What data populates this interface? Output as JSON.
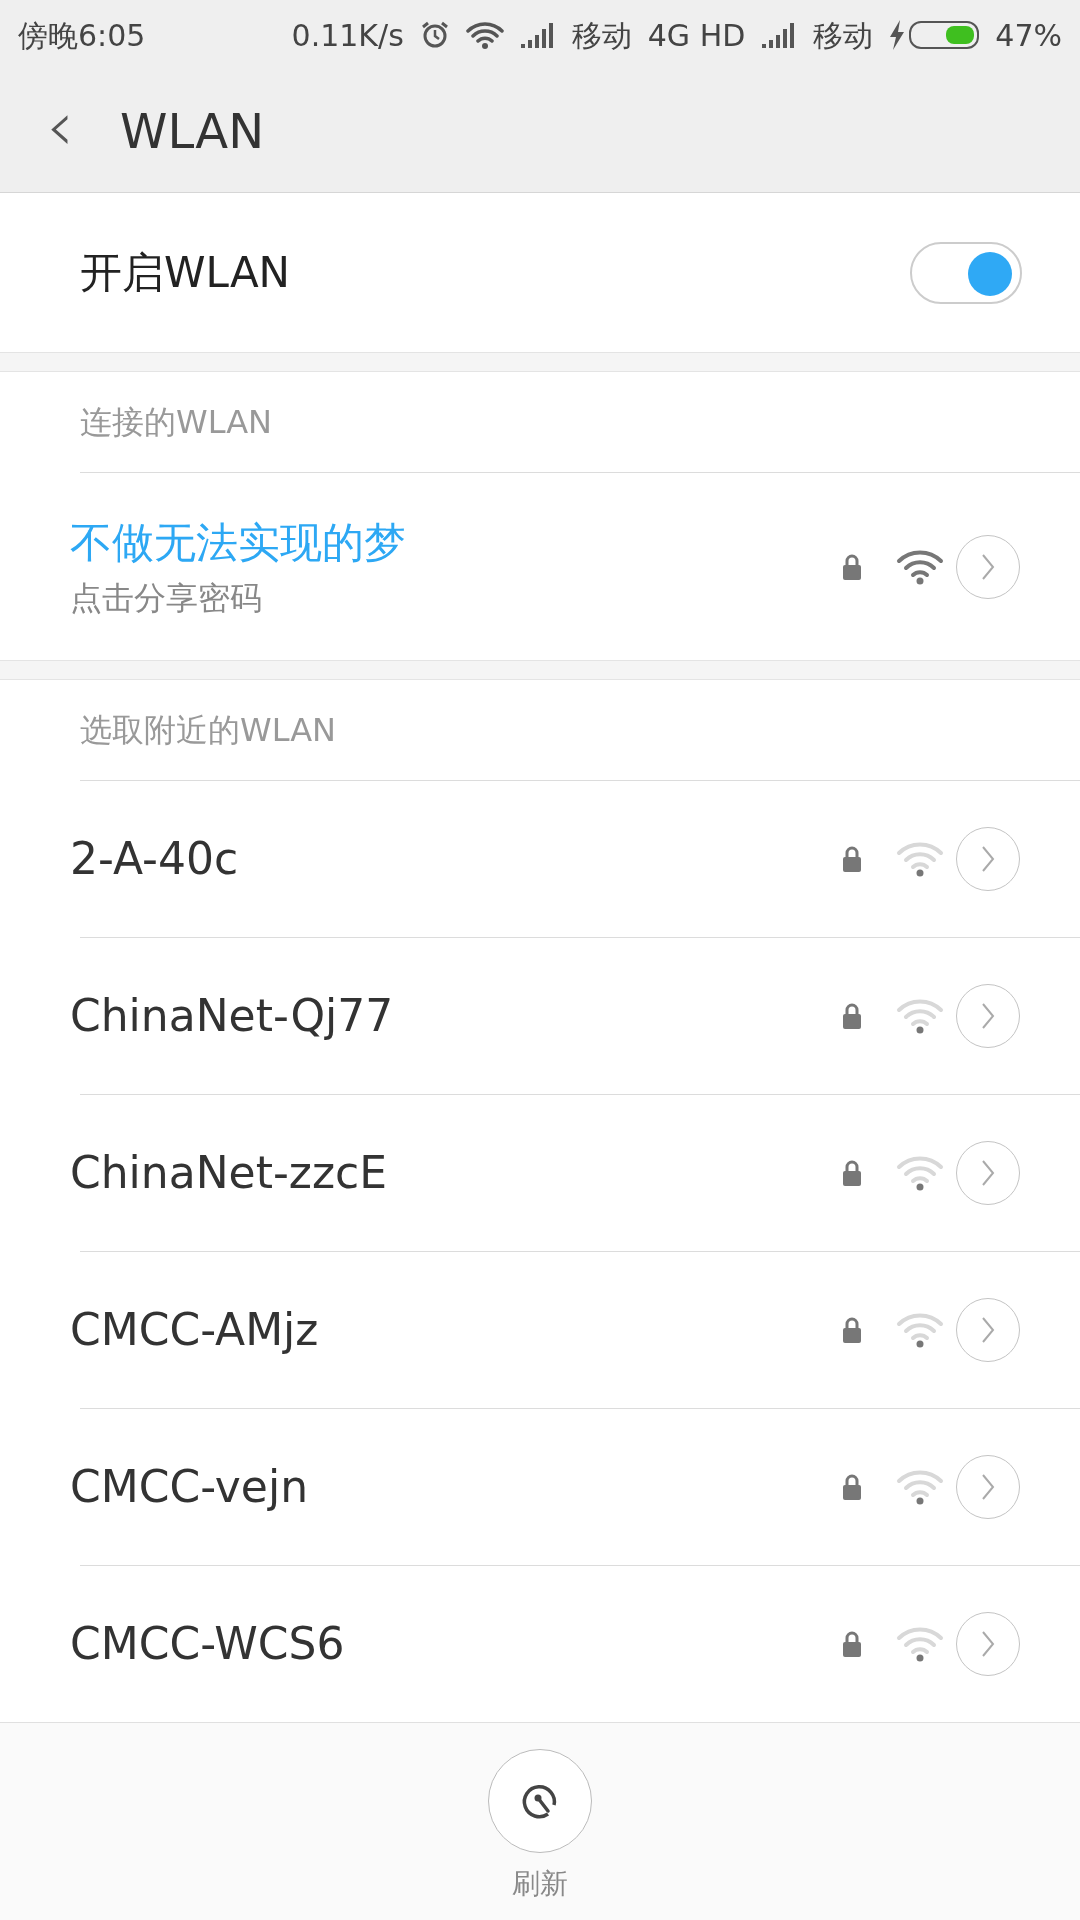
{
  "status_bar": {
    "time": "傍晚6:05",
    "speed": "0.11K/s",
    "carrier_1": "移动",
    "network_type": "4G HD",
    "carrier_2": "移动",
    "battery": {
      "level": 0.47,
      "charging": true
    },
    "battery_text": "47%"
  },
  "header": {
    "back": "‹",
    "title": "WLAN"
  },
  "toggle": {
    "label": "开启WLAN",
    "on": true
  },
  "connected": {
    "section": "连接的WLAN",
    "network": {
      "name": "不做无法实现的梦",
      "subtitle": "点击分享密码",
      "locked": true
    }
  },
  "nearby": {
    "section": "选取附近的WLAN",
    "networks": [
      {
        "name": "2-A-40c",
        "locked": true
      },
      {
        "name": "ChinaNet-Qj77",
        "locked": true
      },
      {
        "name": "ChinaNet-zzcE",
        "locked": true
      },
      {
        "name": "CMCC-AMjz",
        "locked": true
      },
      {
        "name": "CMCC-vejn",
        "locked": true
      },
      {
        "name": "CMCC-WCS6",
        "locked": true
      }
    ]
  },
  "refresh": {
    "label": "刷新"
  }
}
